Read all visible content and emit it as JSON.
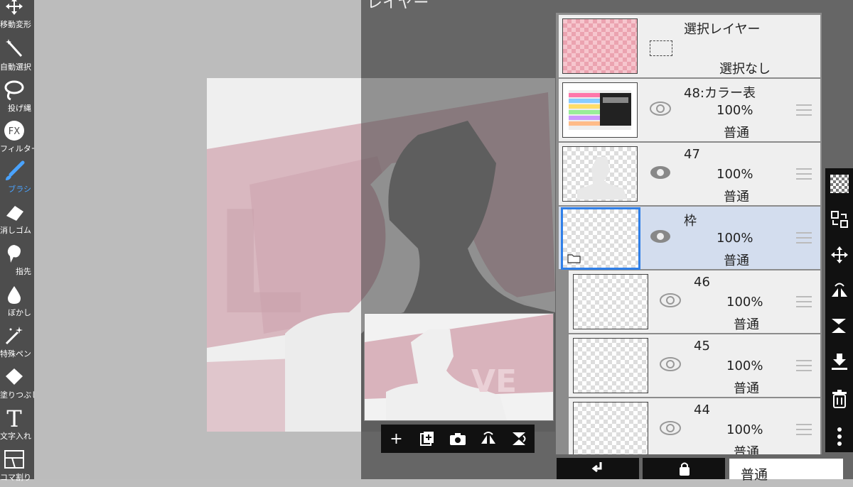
{
  "header": {
    "title": "レイヤー"
  },
  "toolbar": {
    "tools": [
      {
        "label": "移動変形",
        "icon": "move-icon"
      },
      {
        "label": "自動選択",
        "icon": "magic-wand-icon"
      },
      {
        "label": "投げ縄",
        "icon": "lasso-icon"
      },
      {
        "label": "フィルター",
        "icon": "fx-icon",
        "icon_text": "FX"
      },
      {
        "label": "ブラシ",
        "icon": "brush-icon",
        "active": true
      },
      {
        "label": "消しゴム",
        "icon": "eraser-icon"
      },
      {
        "label": "指先",
        "icon": "finger-icon"
      },
      {
        "label": "ぼかし",
        "icon": "blur-icon"
      },
      {
        "label": "特殊ペン",
        "icon": "special-pen-icon"
      },
      {
        "label": "塗りつぶし",
        "icon": "fill-icon"
      },
      {
        "label": "文字入れ",
        "icon": "text-icon",
        "icon_text": "T"
      },
      {
        "label": "コマ割り",
        "icon": "frame-divider-icon"
      }
    ]
  },
  "layers": [
    {
      "name": "選択レイヤー",
      "status": "選択なし",
      "type": "selection"
    },
    {
      "name": "48:カラー表",
      "opacity": "100%",
      "mode": "普通"
    },
    {
      "name": "47",
      "opacity": "100%",
      "mode": "普通"
    },
    {
      "name": "枠",
      "opacity": "100%",
      "mode": "普通",
      "selected": true,
      "folder": true
    },
    {
      "name": "46",
      "opacity": "100%",
      "mode": "普通"
    },
    {
      "name": "45",
      "opacity": "100%",
      "mode": "普通"
    },
    {
      "name": "44",
      "opacity": "100%",
      "mode": "普通"
    }
  ],
  "preview_toolbar": {
    "icons": [
      "add-layer-icon",
      "add-special-layer-icon",
      "camera-icon",
      "flip-horizontal-icon",
      "rotate-icon"
    ],
    "add_glyph": "+"
  },
  "right_tools": {
    "icons": [
      "transparency-icon",
      "layer-select-icon",
      "move-layer-icon",
      "flip-icon",
      "flip-vertical-icon",
      "merge-down-icon",
      "trash-icon",
      "more-icon"
    ]
  },
  "bottom": {
    "blend_mode": "普通"
  },
  "colors": {
    "accent": "#4aa3ff",
    "selection": "#2f7fe8",
    "selected_row": "#d3ddee",
    "canvas_pink": "#d9b3bc"
  }
}
